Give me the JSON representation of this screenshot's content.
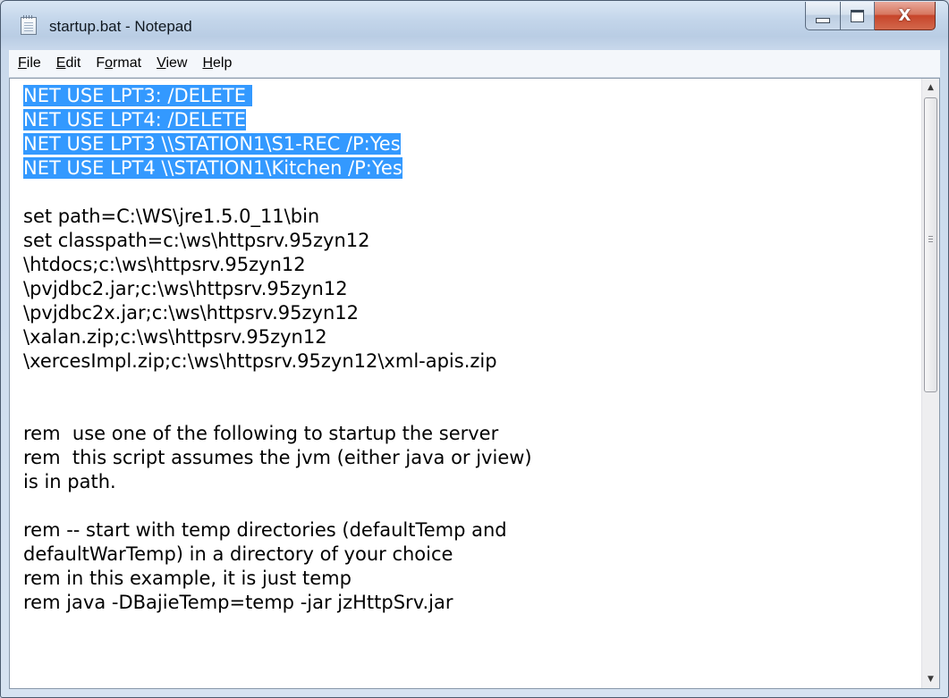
{
  "window": {
    "title": "startup.bat - Notepad",
    "close_glyph": "X",
    "icons": {
      "app": "notepad-icon",
      "minimize": "minimize-icon",
      "maximize": "maximize-icon",
      "close": "close-icon"
    }
  },
  "menu": [
    {
      "hotkey": "F",
      "rest": "ile"
    },
    {
      "hotkey": "E",
      "rest": "dit"
    },
    {
      "pre": "F",
      "hotkey": "o",
      "rest": "rmat"
    },
    {
      "hotkey": "V",
      "rest": "iew"
    },
    {
      "hotkey": "H",
      "rest": "elp"
    }
  ],
  "editor": {
    "selected_lines": [
      "NET USE LPT3: /DELETE ",
      "NET USE LPT4: /DELETE",
      "NET USE LPT3 \\\\STATION1\\S1-REC /P:Yes",
      "NET USE LPT4 \\\\STATION1\\Kitchen /P:Yes"
    ],
    "lines": [
      "",
      "set path=C:\\WS\\jre1.5.0_11\\bin",
      "set classpath=c:\\ws\\httpsrv.95zyn12",
      "\\htdocs;c:\\ws\\httpsrv.95zyn12",
      "\\pvjdbc2.jar;c:\\ws\\httpsrv.95zyn12",
      "\\pvjdbc2x.jar;c:\\ws\\httpsrv.95zyn12",
      "\\xalan.zip;c:\\ws\\httpsrv.95zyn12",
      "\\xercesImpl.zip;c:\\ws\\httpsrv.95zyn12\\xml-apis.zip",
      "",
      "",
      "rem  use one of the following to startup the server",
      "rem  this script assumes the jvm (either java or jview)",
      "is in path.",
      "",
      "rem -- start with temp directories (defaultTemp and",
      "defaultWarTemp) in a directory of your choice",
      "rem in this example, it is just temp",
      "rem java -DBajieTemp=temp -jar jzHttpSrv.jar"
    ]
  },
  "scrollbar": {
    "up_glyph": "▲",
    "down_glyph": "▼"
  },
  "colors": {
    "selection": "#3399ff",
    "close_button": "#c7452a"
  }
}
